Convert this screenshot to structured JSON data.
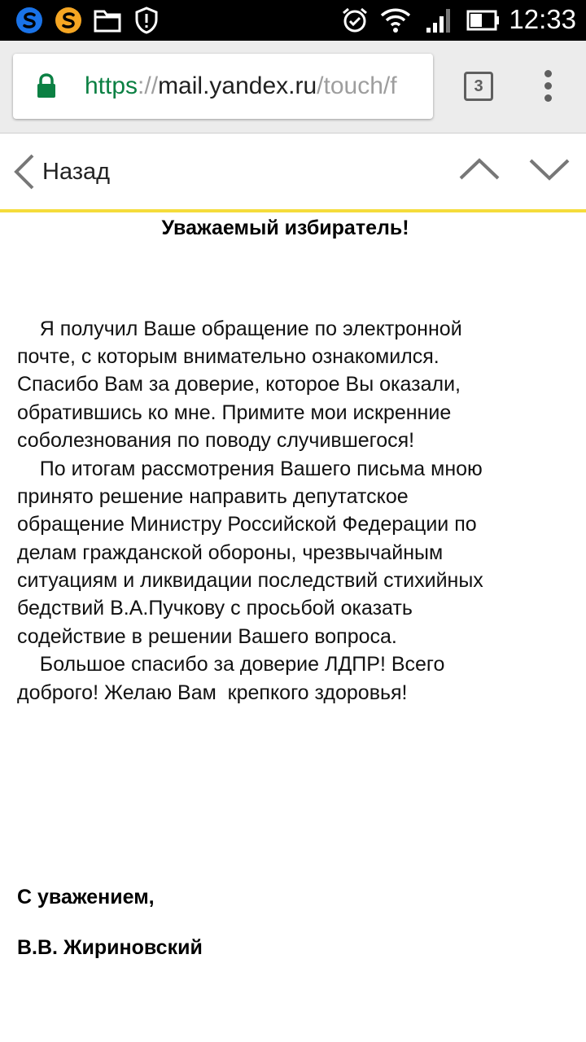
{
  "status_bar": {
    "time": "12:33",
    "icons": [
      "skype-icon",
      "s-app-icon",
      "folder-icon",
      "shield-alert-icon",
      "alarm-icon",
      "wifi-icon",
      "signal-icon",
      "battery-icon"
    ]
  },
  "browser": {
    "url_scheme": "https",
    "url_sep": "://",
    "url_host": "mail.yandex.ru",
    "url_path": "/touch/f",
    "tab_count": "3"
  },
  "mail_header": {
    "back_label": "Назад"
  },
  "letter": {
    "greeting": "Уважаемый избиратель!",
    "lines": [
      "    Я получил Ваше обращение по электронной",
      "почте, с которым внимательно ознакомился.",
      "Спасибо Вам за доверие, которое Вы оказали,",
      "обратившись ко мне. Примите мои искренние",
      "соболезнования по поводу случившегося!",
      "    По итогам рассмотрения Вашего письма мною",
      "принято решение направить депутатское",
      "обращение Министру Российской Федерации по",
      "делам гражданской обороны, чрезвычайным",
      "ситуациям и ликвидации последствий стихийных",
      "бедствий В.А.Пучкову с просьбой оказать",
      "содействие в решении Вашего вопроса.",
      "    Большое спасибо за доверие ЛДПР! Всего",
      "доброго! Желаю Вам  крепкого здоровья!"
    ],
    "closing": "С уважением,",
    "signature": "В.В. Жириновский"
  },
  "colors": {
    "status_bar_bg": "#000000",
    "toolbar_bg": "#ececec",
    "https_green": "#0b8043",
    "header_accent": "#f5dc3b"
  }
}
